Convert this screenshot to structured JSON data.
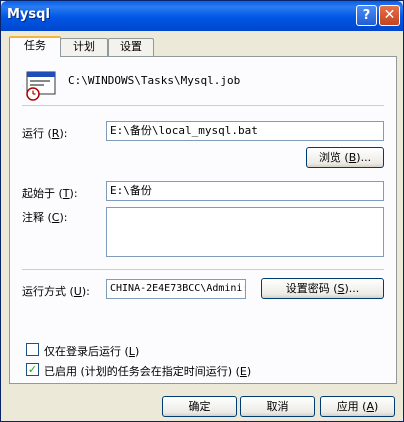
{
  "window": {
    "title": "Mysql"
  },
  "titlebar": {
    "help_glyph": "?",
    "close_glyph": "✕"
  },
  "tabs": [
    {
      "label": "任务"
    },
    {
      "label": "计划"
    },
    {
      "label": "设置"
    }
  ],
  "task": {
    "path": "C:\\WINDOWS\\Tasks\\Mysql.job",
    "run_label": "运行 (",
    "run_key": "R",
    "run_label_end": "):",
    "run_value": "E:\\备份\\local_mysql.bat",
    "browse_label": "浏览 (",
    "browse_key": "B",
    "browse_label_end": ")...",
    "start_label": "起始于 (",
    "start_key": "T",
    "start_label_end": "):",
    "start_value": "E:\\备份",
    "comment_label": "注释 (",
    "comment_key": "C",
    "comment_label_end": "):",
    "comment_value": "",
    "runas_label": "运行方式 (",
    "runas_key": "U",
    "runas_label_end": "):",
    "runas_value": "CHINA-2E4E73BCC\\Admini:",
    "setpwd_label": "设置密码 (",
    "setpwd_key": "S",
    "setpwd_label_end": ")...",
    "logon_only_label": "仅在登录后运行 (",
    "logon_only_key": "L",
    "logon_only_label_end": ")",
    "enabled_label": "已启用 (计划的任务会在指定时间运行) (",
    "enabled_key": "E",
    "enabled_label_end": ")"
  },
  "footer": {
    "ok_label": "确定",
    "cancel_label": "取消",
    "apply_label": "应用 (",
    "apply_key": "A",
    "apply_label_end": ")"
  },
  "colors": {
    "titlebar": "#0055e5",
    "tab_highlight": "#f1b63a",
    "check": "#21a121"
  },
  "icons": {
    "task": "scheduled-task-icon"
  }
}
